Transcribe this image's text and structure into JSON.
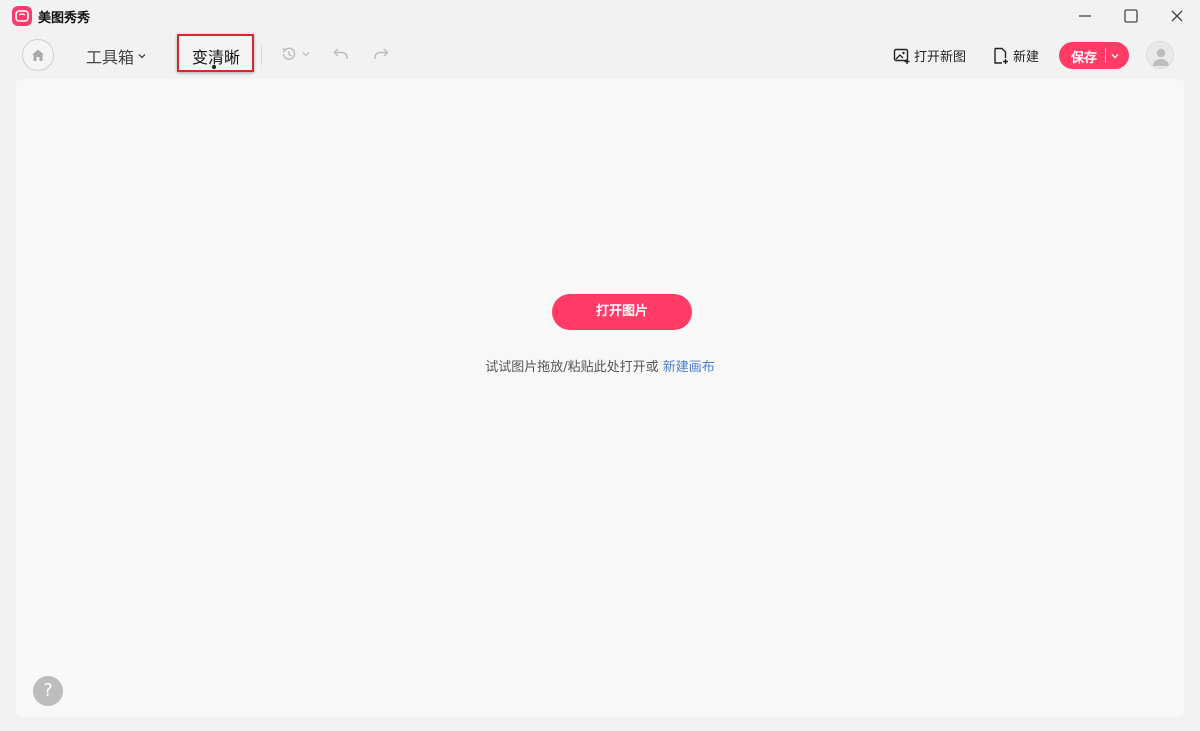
{
  "app": {
    "title": "美图秀秀",
    "brand_color": "#ff3b66"
  },
  "window_controls": [
    "minimize-icon",
    "maximize-icon",
    "close-icon"
  ],
  "toolbar": {
    "home_icon": "home-icon",
    "toolbox_label": "工具箱",
    "active_tab_label": "变清晰",
    "history_icon": "history-icon",
    "undo_icon": "undo-icon",
    "redo_icon": "redo-icon",
    "open_new_label": "打开新图",
    "new_label": "新建",
    "save_label": "保存",
    "avatar_icon": "user-avatar-icon"
  },
  "canvas": {
    "open_image_label": "打开图片",
    "hint_text": "试试图片拖放/粘贴此处打开或 ",
    "hint_link": "新建画布",
    "help_label": "?"
  }
}
